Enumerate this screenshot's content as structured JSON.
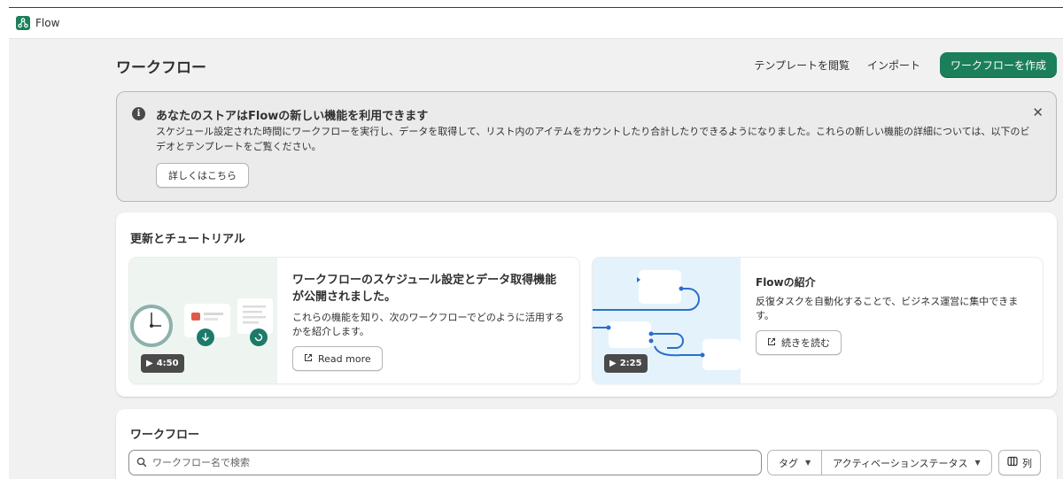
{
  "app": {
    "name": "Flow",
    "icon": "flow-app-icon"
  },
  "header": {
    "title": "ワークフロー",
    "browse_templates": "テンプレートを閲覧",
    "import": "インポート",
    "create_workflow": "ワークフローを作成"
  },
  "banner": {
    "title": "あなたのストアはFlowの新しい機能を利用できます",
    "body": "スケジュール設定された時間にワークフローを実行し、データを取得して、リスト内のアイテムをカウントしたり合計したりできるようになりました。これらの新しい機能の詳細については、以下のビデオとテンプレートをご覧ください。",
    "learn_more": "詳しくはこちら",
    "icon": "info-icon",
    "close_icon": "close-icon"
  },
  "updates": {
    "title": "更新とチュートリアル",
    "tiles": [
      {
        "title": "ワークフローのスケジュール設定とデータ取得機能が公開されました。",
        "text": "これらの機能を知り、次のワークフローでどのように活用するかを紹介します。",
        "button": "Read more",
        "duration": "4:50"
      },
      {
        "title": "Flowの紹介",
        "text": "反復タスクを自動化することで、ビジネス運営に集中できます。",
        "button": "続きを読む",
        "duration": "2:25"
      }
    ]
  },
  "workflows": {
    "title": "ワークフロー",
    "search_placeholder": "ワークフロー名で検索",
    "filter_tag": "タグ",
    "filter_status": "アクティベーションステータス",
    "columns": "列"
  },
  "colors": {
    "primary": "#1b7f5a",
    "background": "#f1f1f1",
    "banner_bg": "#ebebeb",
    "thumb_green": "#eef5f1",
    "thumb_blue": "#e4f3fb",
    "flow_line": "#2c6ecb"
  }
}
